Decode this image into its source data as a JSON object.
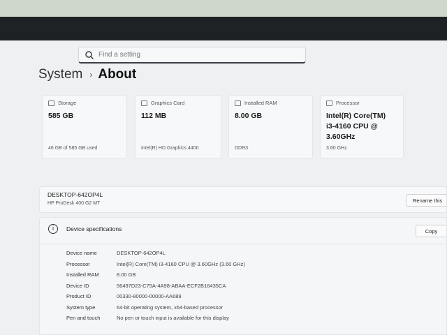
{
  "search": {
    "placeholder": "Find a setting"
  },
  "header": {
    "breadcrumb": "System",
    "separator": "›",
    "current": "About"
  },
  "cards": [
    {
      "label": "Storage",
      "value": "585 GB",
      "sub": "46 GB of 585 GB used",
      "icon": "storage-icon"
    },
    {
      "label": "Graphics Card",
      "value": "112 MB",
      "sub": "Intel(R) HD Graphics 4400",
      "icon": "graphics-card-icon"
    },
    {
      "label": "Installed RAM",
      "value": "8.00 GB",
      "sub": "DDR3",
      "icon": "ram-icon"
    },
    {
      "label": "Processor",
      "value": "Intel(R) Core(TM) i3-4160 CPU @ 3.60GHz",
      "sub": "3.60 GHz",
      "icon": "processor-icon"
    }
  ],
  "device": {
    "name": "DESKTOP-642OP4L",
    "model": "HP ProDesk 400 G2 MT",
    "rename_label": "Rename this"
  },
  "specs": {
    "title": "Device specifications",
    "copy_label": "Copy",
    "rows": [
      {
        "key": "Device name",
        "value": "DESKTOP-642OP4L"
      },
      {
        "key": "Processor",
        "value": "Intel(R) Core(TM) i3-4160 CPU @ 3.60GHz (3.60 GHz)"
      },
      {
        "key": "Installed RAM",
        "value": "8.00 GB"
      },
      {
        "key": "Device ID",
        "value": "56497D23-C75A-4A98-ABAA-ECF2B16435CA"
      },
      {
        "key": "Product ID",
        "value": "00330-80000-00000-AA689"
      },
      {
        "key": "System type",
        "value": "64-bit operating system, x64-based processor"
      },
      {
        "key": "Pen and touch",
        "value": "No pen or touch input is available for this display"
      }
    ]
  }
}
